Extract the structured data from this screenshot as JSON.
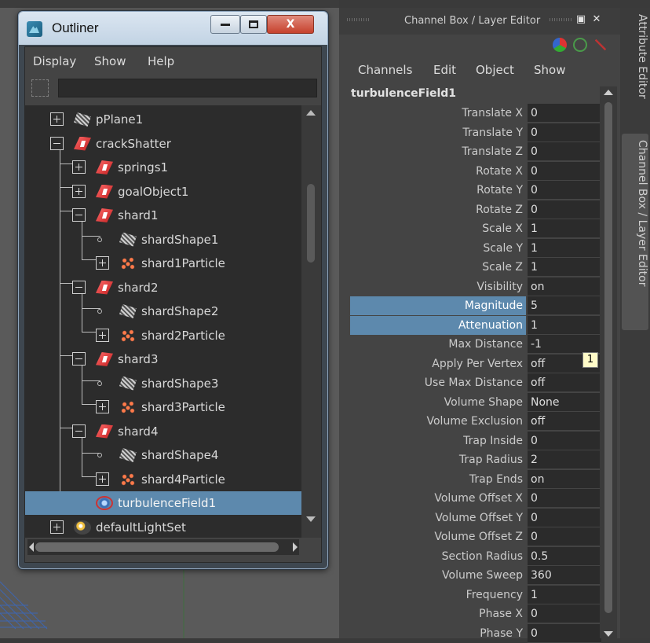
{
  "outliner": {
    "title": "Outliner",
    "menu": [
      "Display",
      "Show",
      "Help"
    ],
    "filter_value": "",
    "tree": [
      {
        "label": "pPlane1",
        "icon": "mesh-icon",
        "expander": "plus",
        "depth": 0
      },
      {
        "label": "crackShatter",
        "icon": "transform-icon",
        "expander": "minus",
        "depth": 0
      },
      {
        "label": "springs1",
        "icon": "transform-icon",
        "expander": "plus",
        "depth": 1
      },
      {
        "label": "goalObject1",
        "icon": "transform-icon",
        "expander": "plus",
        "depth": 1
      },
      {
        "label": "shard1",
        "icon": "transform-icon",
        "expander": "minus",
        "depth": 1
      },
      {
        "label": "shardShape1",
        "icon": "mesh-icon",
        "expander": "node",
        "depth": 2
      },
      {
        "label": "shard1Particle",
        "icon": "particle-icon",
        "expander": "plus",
        "depth": 2
      },
      {
        "label": "shard2",
        "icon": "transform-icon",
        "expander": "minus",
        "depth": 1
      },
      {
        "label": "shardShape2",
        "icon": "mesh-icon",
        "expander": "node",
        "depth": 2
      },
      {
        "label": "shard2Particle",
        "icon": "particle-icon",
        "expander": "plus",
        "depth": 2
      },
      {
        "label": "shard3",
        "icon": "transform-icon",
        "expander": "minus",
        "depth": 1
      },
      {
        "label": "shardShape3",
        "icon": "mesh-icon",
        "expander": "node",
        "depth": 2
      },
      {
        "label": "shard3Particle",
        "icon": "particle-icon",
        "expander": "plus",
        "depth": 2
      },
      {
        "label": "shard4",
        "icon": "transform-icon",
        "expander": "minus",
        "depth": 1
      },
      {
        "label": "shardShape4",
        "icon": "mesh-icon",
        "expander": "node",
        "depth": 2
      },
      {
        "label": "shard4Particle",
        "icon": "particle-icon",
        "expander": "plus",
        "depth": 2
      },
      {
        "label": "turbulenceField1",
        "icon": "field-icon",
        "expander": "none",
        "depth": 1,
        "selected": true
      },
      {
        "label": "defaultLightSet",
        "icon": "lightset-icon",
        "expander": "plus",
        "depth": 0
      }
    ]
  },
  "channel_box": {
    "title": "Channel Box / Layer Editor",
    "menu": [
      "Channels",
      "Edit",
      "Object",
      "Show"
    ],
    "node_name": "turbulenceField1",
    "attributes": [
      {
        "label": "Translate X",
        "value": "0"
      },
      {
        "label": "Translate Y",
        "value": "0"
      },
      {
        "label": "Translate Z",
        "value": "0"
      },
      {
        "label": "Rotate X",
        "value": "0"
      },
      {
        "label": "Rotate Y",
        "value": "0"
      },
      {
        "label": "Rotate Z",
        "value": "0"
      },
      {
        "label": "Scale X",
        "value": "1"
      },
      {
        "label": "Scale Y",
        "value": "1"
      },
      {
        "label": "Scale Z",
        "value": "1"
      },
      {
        "label": "Visibility",
        "value": "on"
      },
      {
        "label": "Magnitude",
        "value": "5",
        "selected": true
      },
      {
        "label": "Attenuation",
        "value": "1",
        "selected": true
      },
      {
        "label": "Max Distance",
        "value": "-1"
      },
      {
        "label": "Apply Per Vertex",
        "value": "off"
      },
      {
        "label": "Use Max Distance",
        "value": "off"
      },
      {
        "label": "Volume Shape",
        "value": "None"
      },
      {
        "label": "Volume Exclusion",
        "value": "off"
      },
      {
        "label": "Trap Inside",
        "value": "0"
      },
      {
        "label": "Trap Radius",
        "value": "2"
      },
      {
        "label": "Trap Ends",
        "value": "on"
      },
      {
        "label": "Volume Offset X",
        "value": "0"
      },
      {
        "label": "Volume Offset Y",
        "value": "0"
      },
      {
        "label": "Volume Offset Z",
        "value": "0"
      },
      {
        "label": "Section Radius",
        "value": "0.5"
      },
      {
        "label": "Volume Sweep",
        "value": "360"
      },
      {
        "label": "Frequency",
        "value": "1"
      },
      {
        "label": "Phase X",
        "value": "0"
      },
      {
        "label": "Phase Y",
        "value": "0"
      }
    ],
    "tooltip": "1"
  },
  "side_tabs": {
    "attribute_editor": "Attribute Editor",
    "channel_box_layer_editor": "Channel Box / Layer Editor"
  },
  "colors": {
    "selection": "#5d89ad",
    "panel": "#444444",
    "tree_bg": "#2c2c2c"
  }
}
